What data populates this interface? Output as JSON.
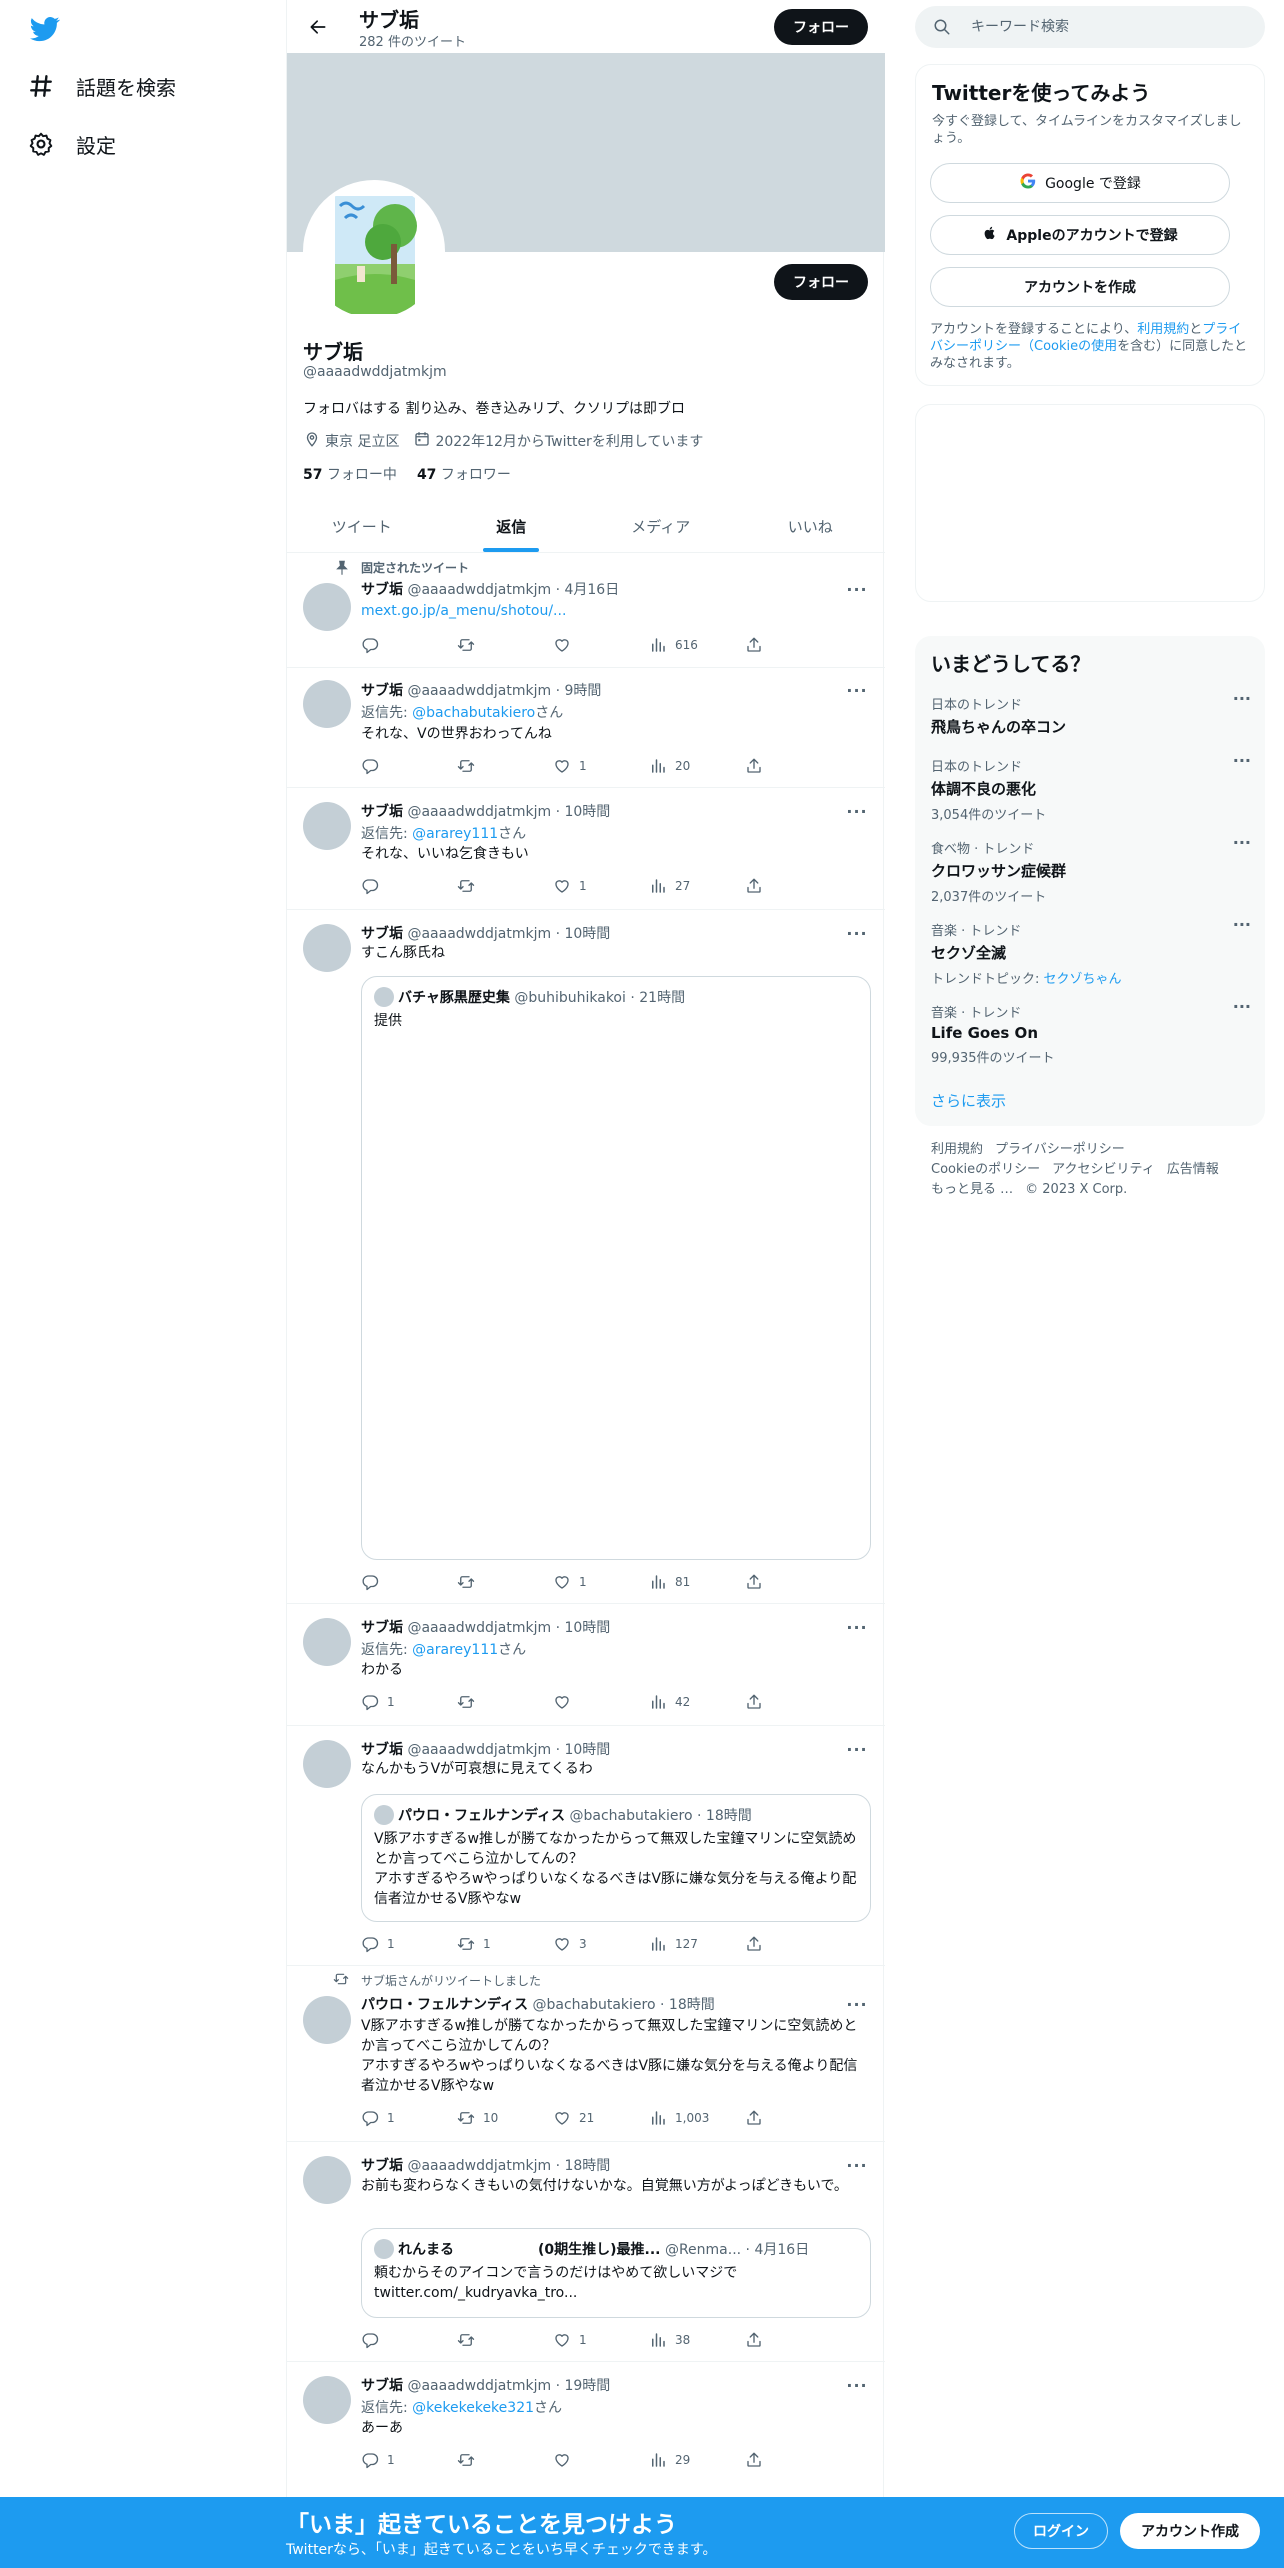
{
  "nav": {
    "explore_label": "話題を検索",
    "settings_label": "設定"
  },
  "header": {
    "title": "サブ垢",
    "subtitle": "282 件のツイート",
    "follow_label": "フォロー"
  },
  "profile": {
    "follow_label": "フォロー",
    "name": "サブ垢",
    "handle": "@aaaadwddjatmkjm",
    "bio": "フォロバはする 割り込み、巻き込みリプ、クソリプは即ブロ",
    "location": "東京 足立区",
    "joined": "2022年12月からTwitterを利用しています",
    "following_count": "57",
    "following_label": "フォロー中",
    "followers_count": "47",
    "followers_label": "フォロワー"
  },
  "tabs": [
    "ツイート",
    "返信",
    "メディア",
    "いいね"
  ],
  "tweets": [
    {
      "context": "固定されたツイート",
      "name": "サブ垢",
      "handle": "@aaaadwddjatmkjm",
      "time": "4月16日",
      "link": "mext.go.jp/a_menu/shotou/...",
      "replies": "",
      "retweets": "",
      "likes": "",
      "views": "616"
    },
    {
      "name": "サブ垢",
      "handle": "@aaaadwddjatmkjm",
      "time": "9時間",
      "reply_prefix": "返信先: ",
      "reply_to": "@bachabutakiero",
      "reply_suffix": "さん",
      "text": "それな、Vの世界おわってんね",
      "replies": "",
      "retweets": "",
      "likes": "1",
      "views": "20"
    },
    {
      "name": "サブ垢",
      "handle": "@aaaadwddjatmkjm",
      "time": "10時間",
      "reply_prefix": "返信先: ",
      "reply_to": "@ararey111",
      "reply_suffix": "さん",
      "text": "それな、いいね乞食きもい",
      "replies": "",
      "retweets": "",
      "likes": "1",
      "views": "27"
    },
    {
      "name": "サブ垢",
      "handle": "@aaaadwddjatmkjm",
      "time": "10時間",
      "text": "すこん豚氏ね",
      "quote": {
        "name": "バチャ豚黒歴史集",
        "handle": "@buhibuhikakoi",
        "time": "21時間",
        "text": "提供"
      },
      "replies": "",
      "retweets": "",
      "likes": "1",
      "views": "81"
    },
    {
      "name": "サブ垢",
      "handle": "@aaaadwddjatmkjm",
      "time": "10時間",
      "reply_prefix": "返信先: ",
      "reply_to": "@ararey111",
      "reply_suffix": "さん",
      "text": "わかる",
      "replies": "1",
      "retweets": "",
      "likes": "",
      "views": "42"
    },
    {
      "name": "サブ垢",
      "handle": "@aaaadwddjatmkjm",
      "time": "10時間",
      "text": "なんかもうVが可哀想に見えてくるわ",
      "quote": {
        "name": "パウロ・フェルナンディス",
        "handle": "@bachabutakiero",
        "time": "18時間",
        "text": "V豚アホすぎるw推しが勝てなかったからって無双した宝鐘マリンに空気読めとか言ってべこら泣かしてんの？\nアホすぎるやろwやっぱりいなくなるべきはV豚に嫌な気分を与える俺より配信者泣かせるV豚やなw"
      },
      "replies": "1",
      "retweets": "1",
      "likes": "3",
      "views": "127"
    },
    {
      "context": "サブ垢さんがリツイートしました",
      "name": "パウロ・フェルナンディス",
      "handle": "@bachabutakiero",
      "time": "18時間",
      "text": "V豚アホすぎるw推しが勝てなかったからって無双した宝鐘マリンに空気読めとか言ってべこら泣かしてんの？\nアホすぎるやろwやっぱりいなくなるべきはV豚に嫌な気分を与える俺より配信者泣かせるV豚やなw",
      "replies": "1",
      "retweets": "10",
      "likes": "21",
      "views": "1,003"
    },
    {
      "name": "サブ垢",
      "handle": "@aaaadwddjatmkjm",
      "time": "18時間",
      "text": "お前も変わらなくきもいの気付けないかな。自覚無い方がよっぽどきもいで。",
      "quote": {
        "name": "れんまる　　　　　　(0期生推し)最推...",
        "handle": "@Renma...",
        "time": "4月16日",
        "text": "頼むからそのアイコンで言うのだけはやめて欲しいマジで\ntwitter.com/_kudryavka_tro..."
      },
      "replies": "",
      "retweets": "",
      "likes": "1",
      "views": "38"
    },
    {
      "name": "サブ垢",
      "handle": "@aaaadwddjatmkjm",
      "time": "19時間",
      "reply_prefix": "返信先: ",
      "reply_to": "@kekekekeke321",
      "reply_suffix": "さん",
      "text": "あーあ",
      "replies": "1",
      "retweets": "",
      "likes": "",
      "views": "29"
    }
  ],
  "sidebar": {
    "search_placeholder": "キーワード検索",
    "signup": {
      "title": "Twitterを使ってみよう",
      "desc": "今すぐ登録して、タイムラインをカスタマイズしましょう。",
      "google_label": "Google で登録",
      "apple_label": "Appleのアカウントで登録",
      "create_label": "アカウントを作成",
      "legal_1": "アカウントを登録することにより、",
      "legal_terms": "利用規約",
      "legal_2": "と",
      "legal_privacy": "プライバシーポリシー（Cookieの使用",
      "legal_3": "を含む）に同意したとみなされます。"
    },
    "trends": {
      "title": "いまどうしてる？",
      "items": [
        {
          "context": "日本のトレンド",
          "name": "飛鳥ちゃんの卒コン",
          "count": ""
        },
        {
          "context": "日本のトレンド",
          "name": "体調不良の悪化",
          "count": "3,054件のツイート"
        },
        {
          "context": "食べ物 · トレンド",
          "name": "クロワッサン症候群",
          "count": "2,037件のツイート"
        },
        {
          "context": "音楽 · トレンド",
          "name": "セクゾ全滅",
          "count_prefix": "トレンドトピック: ",
          "count_link": "セクゾちゃん"
        },
        {
          "context": "音楽 · トレンド",
          "name": "Life Goes On",
          "count": "99,935件のツイート"
        }
      ],
      "show_more": "さらに表示"
    },
    "footer": [
      "利用規約",
      "プライバシーポリシー",
      "Cookieのポリシー",
      "アクセシビリティ",
      "広告情報",
      "もっと見る …",
      "© 2023 X Corp."
    ]
  },
  "bottombar": {
    "title": "「いま」起きていることを見つけよう",
    "subtitle": "Twitterなら、「いま」起きていることをいち早くチェックできます。",
    "login_label": "ログイン",
    "create_label": "アカウント作成"
  }
}
